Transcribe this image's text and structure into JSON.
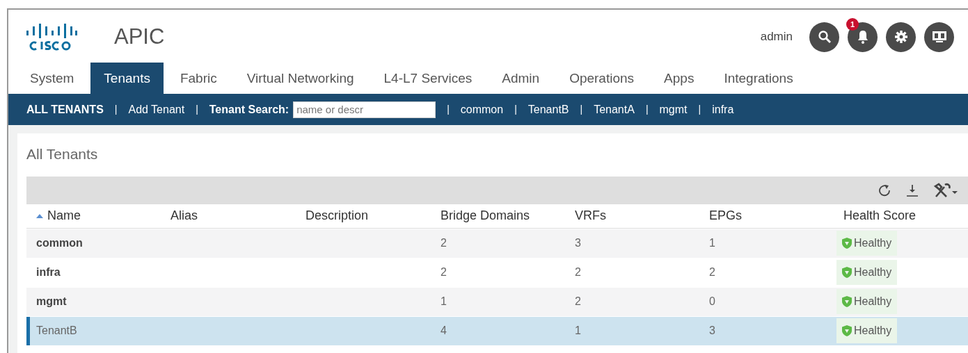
{
  "header": {
    "app_title": "APIC",
    "user": "admin",
    "notification_count": "1"
  },
  "tabs": [
    {
      "label": "System",
      "selected": false
    },
    {
      "label": "Tenants",
      "selected": true
    },
    {
      "label": "Fabric",
      "selected": false
    },
    {
      "label": "Virtual Networking",
      "selected": false
    },
    {
      "label": "L4-L7 Services",
      "selected": false
    },
    {
      "label": "Admin",
      "selected": false
    },
    {
      "label": "Operations",
      "selected": false
    },
    {
      "label": "Apps",
      "selected": false
    },
    {
      "label": "Integrations",
      "selected": false
    }
  ],
  "subnav": {
    "items": [
      {
        "kind": "link",
        "label": "ALL TENANTS",
        "selected": true
      },
      {
        "kind": "link",
        "label": "Add Tenant",
        "selected": false
      },
      {
        "kind": "search",
        "label": "Tenant Search:",
        "placeholder": "name or descr"
      },
      {
        "kind": "link",
        "label": "common",
        "selected": false
      },
      {
        "kind": "link",
        "label": "TenantB",
        "selected": false
      },
      {
        "kind": "link",
        "label": "TenantA",
        "selected": false
      },
      {
        "kind": "link",
        "label": "mgmt",
        "selected": false
      },
      {
        "kind": "link",
        "label": "infra",
        "selected": false
      }
    ],
    "separator": "|"
  },
  "panel": {
    "title": "All Tenants"
  },
  "table": {
    "columns": [
      {
        "label": "Name",
        "sorted": true
      },
      {
        "label": "Alias",
        "sorted": false
      },
      {
        "label": "Description",
        "sorted": false
      },
      {
        "label": "Bridge Domains",
        "sorted": false
      },
      {
        "label": "VRFs",
        "sorted": false
      },
      {
        "label": "EPGs",
        "sorted": false
      },
      {
        "label": "Health Score",
        "sorted": false
      }
    ],
    "rows": [
      {
        "name": "common",
        "bridge_domains": "2",
        "vrfs": "3",
        "epgs": "1",
        "health": "Healthy",
        "selected": false
      },
      {
        "name": "infra",
        "bridge_domains": "2",
        "vrfs": "2",
        "epgs": "2",
        "health": "Healthy",
        "selected": false
      },
      {
        "name": "mgmt",
        "bridge_domains": "1",
        "vrfs": "2",
        "epgs": "0",
        "health": "Healthy",
        "selected": false
      },
      {
        "name": "TenantB",
        "bridge_domains": "4",
        "vrfs": "1",
        "epgs": "3",
        "health": "Healthy",
        "selected": true
      }
    ]
  }
}
